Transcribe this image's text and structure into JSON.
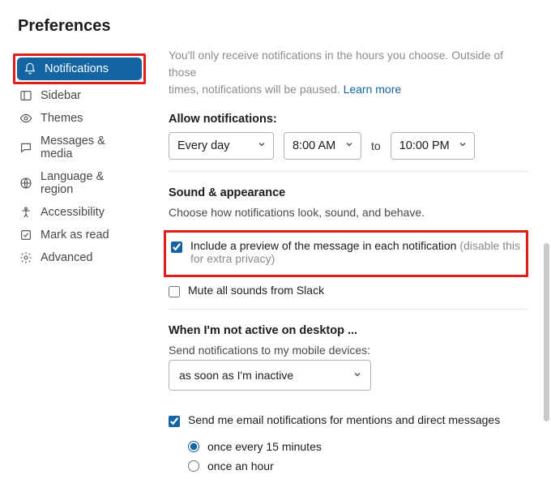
{
  "title": "Preferences",
  "sidebar": {
    "items": [
      {
        "label": "Notifications"
      },
      {
        "label": "Sidebar"
      },
      {
        "label": "Themes"
      },
      {
        "label": "Messages & media"
      },
      {
        "label": "Language & region"
      },
      {
        "label": "Accessibility"
      },
      {
        "label": "Mark as read"
      },
      {
        "label": "Advanced"
      }
    ]
  },
  "top": {
    "cut_line1": "You'll only receive notifications in the hours you choose. Outside of those",
    "cut_line2": "times, notifications will be paused. ",
    "learn_more": "Learn more"
  },
  "allow": {
    "heading": "Allow notifications:",
    "day": "Every day",
    "start": "8:00 AM",
    "to": "to",
    "end": "10:00 PM"
  },
  "sound": {
    "heading": "Sound & appearance",
    "sub": "Choose how notifications look, sound, and behave.",
    "preview_main": "Include a preview of the message in each notification ",
    "preview_hint": "(disable this for extra privacy)",
    "mute": "Mute all sounds from Slack"
  },
  "inactive": {
    "heading": "When I'm not active on desktop ...",
    "sub": "Send notifications to my mobile devices:",
    "value": "as soon as I'm inactive"
  },
  "email": {
    "label": "Send me email notifications for mentions and direct messages",
    "opt1": "once every 15 minutes",
    "opt2": "once an hour"
  }
}
